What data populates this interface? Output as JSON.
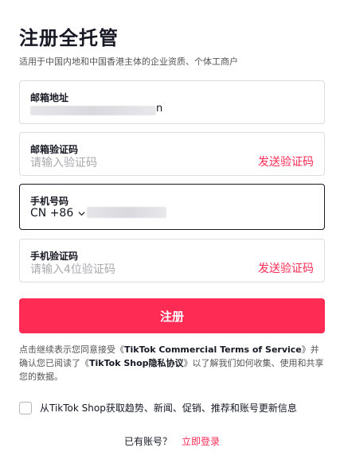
{
  "header": {
    "title": "注册全托管",
    "subtitle": "适用于中国内地和中国香港主体的企业资质、个体工商户"
  },
  "email": {
    "label": "邮箱地址",
    "value_visible_suffix": "n"
  },
  "email_code": {
    "label": "邮箱验证码",
    "placeholder": "请输入验证码",
    "send_label": "发送验证码"
  },
  "phone": {
    "label": "手机号码",
    "country_code": "CN +86",
    "chevron_icon": "chevron-down-icon"
  },
  "phone_code": {
    "label": "手机验证码",
    "placeholder": "请输入4位验证码",
    "send_label": "发送验证码"
  },
  "submit": {
    "label": "注册"
  },
  "consent": {
    "prefix": "点击继续表示您同意接受《",
    "terms": "TikTok Commercial Terms of Service",
    "middle": "》并确认您已阅读了《",
    "privacy": "TikTok Shop隐私协议",
    "suffix": "》以了解我们如何收集、使用和共享您的数据。"
  },
  "marketing": {
    "label": "从TikTok Shop获取趋势、新闻、促销、推荐和账号更新信息"
  },
  "login": {
    "prompt": "已有账号？",
    "link": "立即登录"
  },
  "colors": {
    "accent": "#fe2c55",
    "text": "#161823",
    "border": "#dcdcdf"
  }
}
